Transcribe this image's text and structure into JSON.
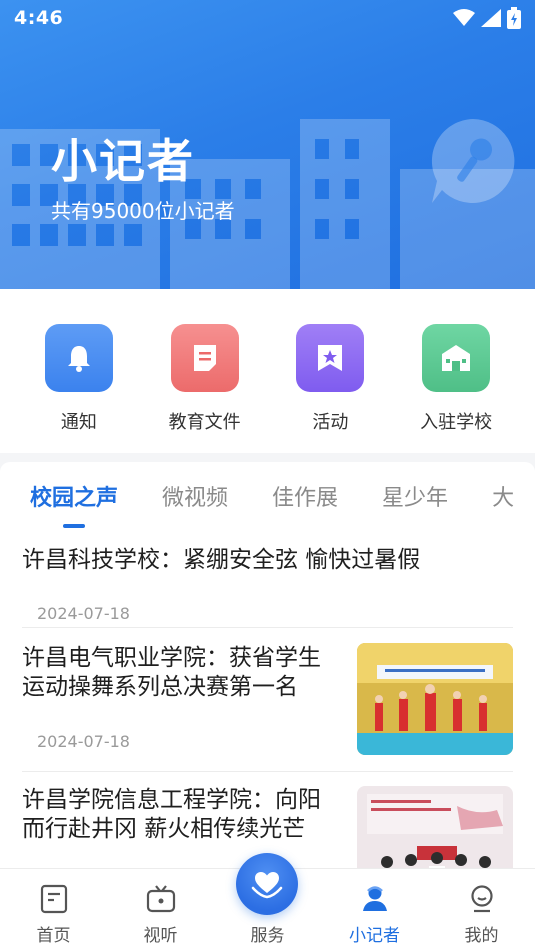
{
  "status_bar": {
    "time": "4:46"
  },
  "header": {
    "title": "小记者",
    "subtitle": "共有95000位小记者"
  },
  "quick_actions": [
    {
      "label": "通知",
      "icon": "bell-icon",
      "color": "#4a8ff0"
    },
    {
      "label": "教育文件",
      "icon": "document-icon",
      "color": "#f07c7c"
    },
    {
      "label": "活动",
      "icon": "bookmark-star-icon",
      "color": "#8d6df2"
    },
    {
      "label": "入驻学校",
      "icon": "school-icon",
      "color": "#5cc794"
    }
  ],
  "tabs": [
    {
      "label": "校园之声",
      "active": true
    },
    {
      "label": "微视频",
      "active": false
    },
    {
      "label": "佳作展",
      "active": false
    },
    {
      "label": "星少年",
      "active": false
    },
    {
      "label": "大",
      "active": false
    }
  ],
  "articles": [
    {
      "title": "许昌科技学校：紧绷安全弦 愉快过暑假",
      "date": "2024-07-18",
      "has_image": false
    },
    {
      "title": "许昌电气职业学院：获省学生运动操舞系列总决赛第一名",
      "date": "2024-07-18",
      "has_image": true
    },
    {
      "title": "许昌学院信息工程学院：向阳而行赴井冈 薪火相传续光芒",
      "date": "",
      "has_image": true
    }
  ],
  "bottom_nav": [
    {
      "label": "首页",
      "icon": "home-doc-icon",
      "active": false
    },
    {
      "label": "视听",
      "icon": "tv-icon",
      "active": false
    },
    {
      "label": "服务",
      "icon": "heart-hands-icon",
      "active": false
    },
    {
      "label": "小记者",
      "icon": "reporter-icon",
      "active": true
    },
    {
      "label": "我的",
      "icon": "profile-icon",
      "active": false
    }
  ],
  "colors": {
    "accent": "#1f6fe0",
    "hero_start": "#3c92f0",
    "hero_end": "#1f6fe0"
  }
}
